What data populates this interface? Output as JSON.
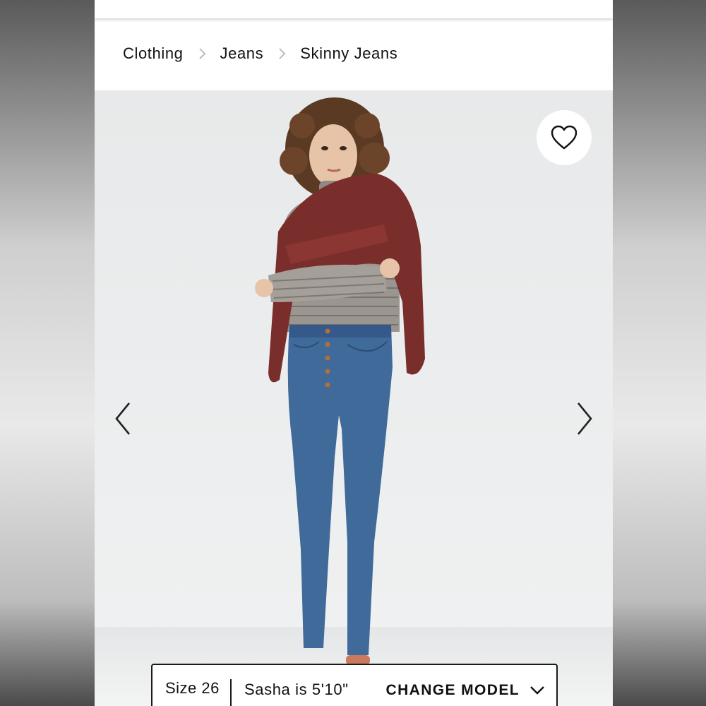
{
  "breadcrumb": {
    "items": [
      {
        "label": "Clothing"
      },
      {
        "label": "Jeans"
      },
      {
        "label": "Skinny Jeans"
      }
    ]
  },
  "gallery": {
    "favorite_icon": "heart-outline-icon",
    "prev_icon": "chevron-left-icon",
    "next_icon": "chevron-right-icon"
  },
  "model_selector": {
    "size_label": "Size 26",
    "model_info": "Sasha is 5'10\"",
    "change_label": "CHANGE MODEL",
    "dropdown_icon": "chevron-down-icon"
  },
  "colors": {
    "accent": "#111111",
    "jacket": "#7a2e2b",
    "denim": "#3f6a9a"
  }
}
